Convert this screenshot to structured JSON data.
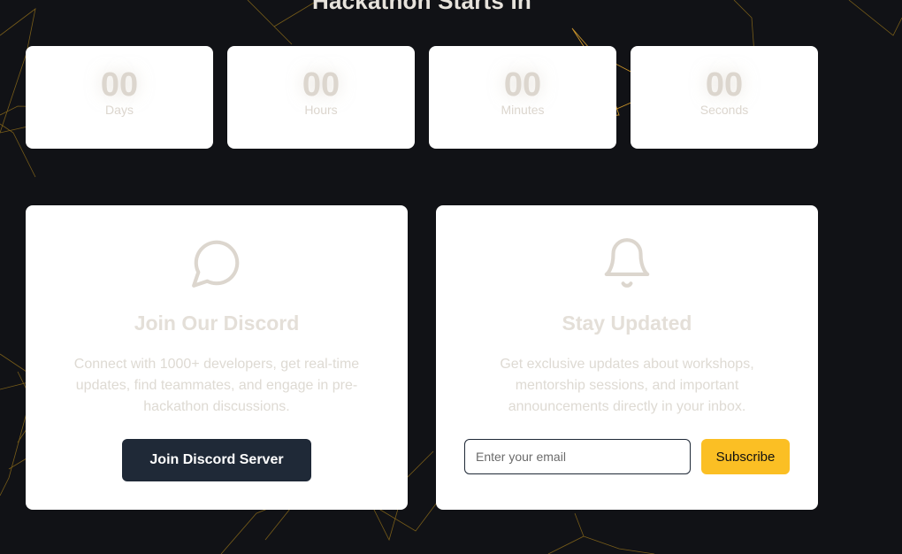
{
  "header": {
    "title": "Hackathon Starts In"
  },
  "countdown": [
    {
      "value": "00",
      "label": "Days"
    },
    {
      "value": "00",
      "label": "Hours"
    },
    {
      "value": "00",
      "label": "Minutes"
    },
    {
      "value": "00",
      "label": "Seconds"
    }
  ],
  "discord": {
    "icon": "chat-bubble-icon",
    "title": "Join Our Discord",
    "description": "Connect with 1000+ developers, get real-time updates, find teammates, and engage in pre-hackathon discussions.",
    "button_label": "Join Discord Server"
  },
  "updates": {
    "icon": "bell-icon",
    "title": "Stay Updated",
    "description": "Get exclusive updates about workshops, mentorship sessions, and important announcements directly in your inbox.",
    "email_placeholder": "Enter your email",
    "button_label": "Subscribe"
  },
  "colors": {
    "background": "#111216",
    "accent": "#fbbf24",
    "dark_button": "#1f2937",
    "muted_text": "#dcd6ce"
  }
}
